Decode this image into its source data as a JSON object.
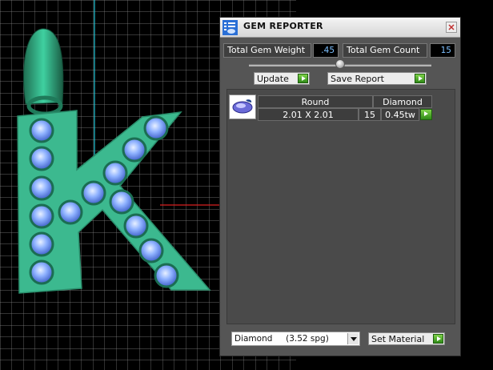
{
  "window": {
    "title": "GEM REPORTER"
  },
  "stats": {
    "weight_label": "Total Gem Weight",
    "weight_value": ".45",
    "count_label": "Total Gem Count",
    "count_value": "15"
  },
  "toolbar": {
    "update_label": "Update",
    "save_report_label": "Save Report"
  },
  "gem_list": {
    "columns": [
      "Round",
      "Diamond"
    ],
    "rows": [
      {
        "size": "2.01 X 2.01",
        "count": "15",
        "weight": "0.45tw"
      }
    ]
  },
  "material": {
    "selected": "Diamond     (3.52 spg)",
    "set_material_label": "Set Material"
  },
  "colors": {
    "panel_bg": "#555555",
    "value_text": "#7ec0ff",
    "accent_green": "#3aa81e",
    "model_green": "#3cb98f",
    "gem_blue": "#7aa8ff"
  }
}
